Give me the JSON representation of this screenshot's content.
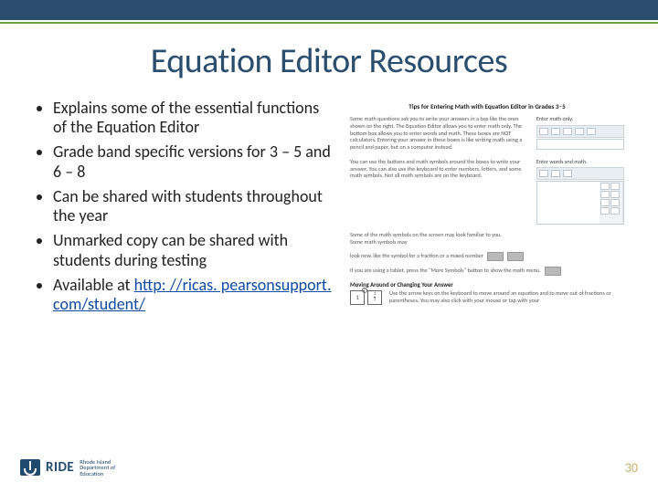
{
  "title": "Equation Editor Resources",
  "bullets": [
    "Explains some of the essential functions of the Equation Editor",
    "Grade band specific versions for 3 – 5 and 6 – 8",
    "Can be shared with students throughout the year",
    "Unmarked copy can be shared with students during testing"
  ],
  "available_label": "Available at",
  "link_text": "http: //ricas. pearsonsupport. com/student/",
  "doc": {
    "title": "Tips for Entering Math with Equation Editor in Grades 3–5",
    "label1": "Enter math only.",
    "label2": "Enter words and math.",
    "para1": "Some math questions ask you to write your answers in a box like the ones shown on the right. The Equation Editor allows you to enter math only. The bottom box allows you to enter words and math. These boxes are NOT calculators. Entering your answer in these boxes is like writing math using a pencil and paper, but on a computer instead.",
    "para2": "You can use the buttons and math symbols around the boxes to write your answer. You can also use the keyboard to enter numbers, letters, and some math symbols. Not all math symbols are on the keyboard.",
    "para3": "Some of the math symbols on the screen may look familiar to you. Some math symbols may",
    "frac_line": "look new, like the symbol for a fraction          or a mixed number",
    "tablet_line": "If you are using a tablet, press the \"More Symbols\" button          to show the math menu.",
    "move_title": "Moving Around or Changing Your Answer",
    "move_text": "Use the arrow keys on the keyboard to move around an equation and to move out of fractions or parentheses. You may also click with your mouse or tap with your"
  },
  "logo": {
    "word": "RIDE",
    "line1": "Rhode Island",
    "line2": "Department of",
    "line3": "Education"
  },
  "page_number": "30"
}
